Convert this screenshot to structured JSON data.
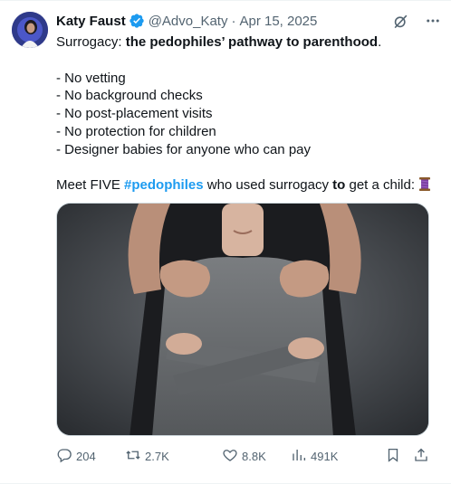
{
  "author": {
    "name": "Katy Faust",
    "handle": "@Advo_Katy",
    "separator": "·",
    "date": "Apr 15, 2025",
    "verified": true
  },
  "tweet": {
    "line1_prefix": "Surrogacy: ",
    "line1_bold": "the pedophiles’ pathway to parenthood",
    "line1_suffix": ".",
    "bullets": [
      "- No vetting",
      "- No background checks",
      "- No post-placement visits",
      "- No protection for children",
      "- Designer babies for anyone who can pay"
    ],
    "closing_prefix": "Meet FIVE ",
    "closing_hashtag": "#pedophiles",
    "closing_middle": " who used surrogacy ",
    "closing_bold": "to",
    "closing_suffix": " get a child: "
  },
  "actions": {
    "replies": "204",
    "reposts": "2.7K",
    "likes": "8.8K",
    "views": "491K"
  },
  "icons": {
    "reply": "reply-icon",
    "repost": "repost-icon",
    "like": "heart-icon",
    "views": "views-icon",
    "bookmark": "bookmark-icon",
    "share": "share-icon",
    "grok": "grok-icon",
    "more": "more-icon",
    "thread": "thread-spool-icon"
  },
  "colors": {
    "accent": "#1d9bf0",
    "text": "#0f1419",
    "secondary": "#536471"
  }
}
